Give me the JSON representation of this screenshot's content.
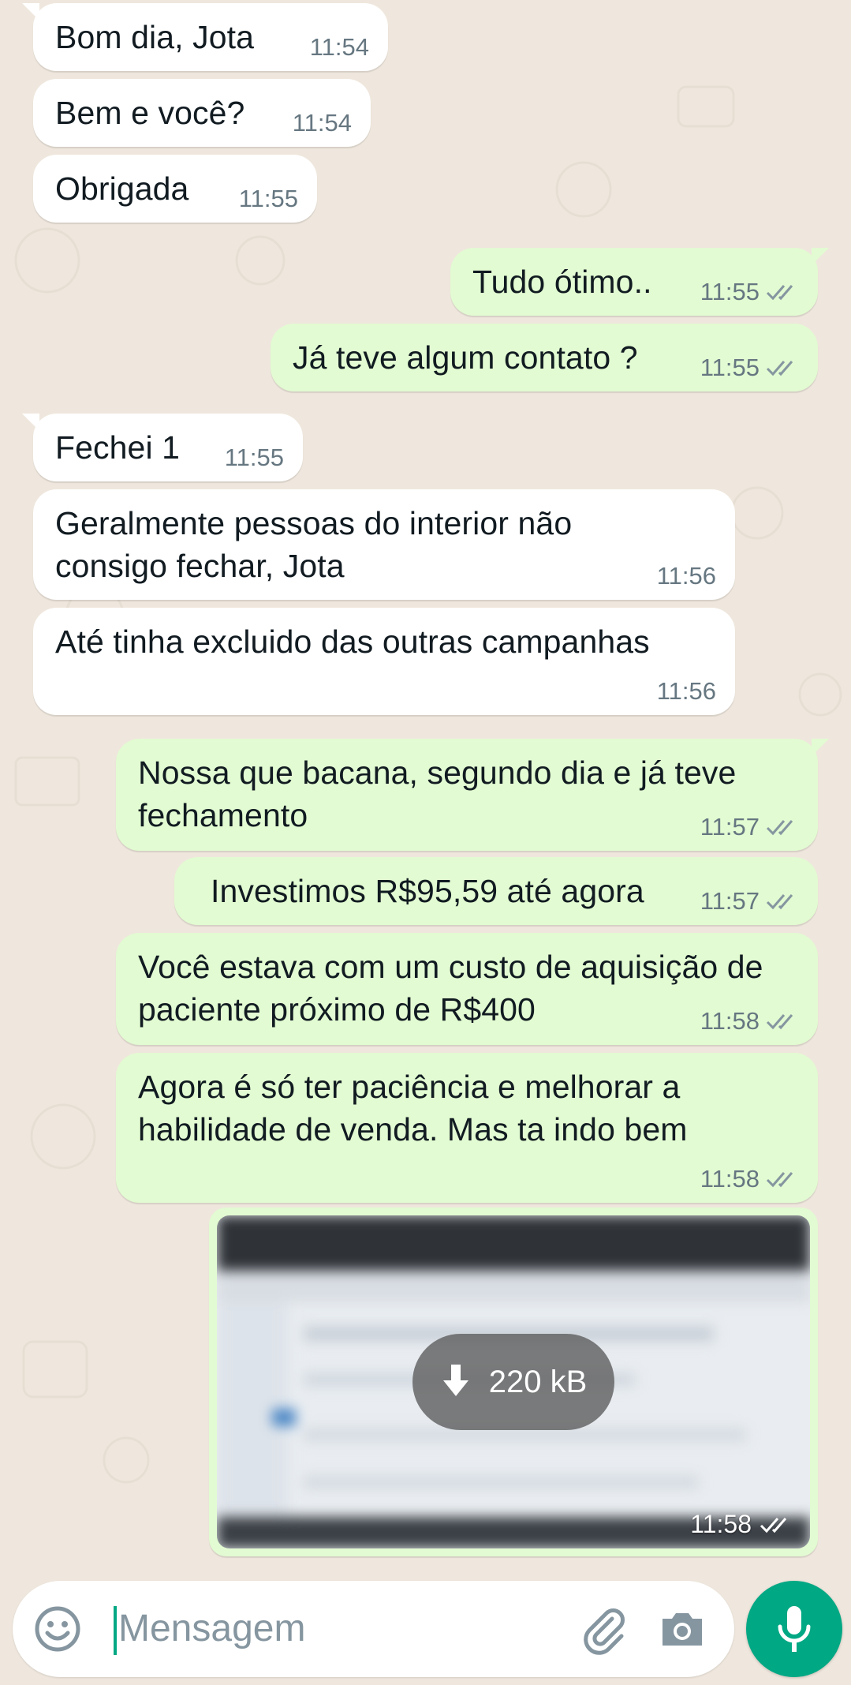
{
  "messages": [
    {
      "dir": "in",
      "text": "Bom dia, Jota",
      "time": "11:54"
    },
    {
      "dir": "in",
      "text": "Bem e você?",
      "time": "11:54"
    },
    {
      "dir": "in",
      "text": "Obrigada",
      "time": "11:55"
    },
    {
      "dir": "out",
      "text": "Tudo ótimo..",
      "time": "11:55"
    },
    {
      "dir": "out",
      "text": "Já teve algum contato ?",
      "time": "11:55"
    },
    {
      "dir": "in",
      "text": "Fechei 1",
      "time": "11:55"
    },
    {
      "dir": "in",
      "text": "Geralmente pessoas do interior não consigo fechar, Jota",
      "time": "11:56"
    },
    {
      "dir": "in",
      "text": "Até tinha excluido das outras campanhas",
      "time": "11:56"
    },
    {
      "dir": "out",
      "text": "Nossa que bacana, segundo dia e já teve fechamento",
      "time": "11:57"
    },
    {
      "dir": "out",
      "text": "Investimos R$95,59 até agora",
      "time": "11:57"
    },
    {
      "dir": "out",
      "text": "Você estava com um custo de aquisição de paciente próximo de R$400",
      "time": "11:58"
    },
    {
      "dir": "out",
      "text": "Agora é só ter paciência e melhorar a habilidade de venda. Mas ta indo bem",
      "time": "11:58"
    }
  ],
  "image_message": {
    "size": "220 kB",
    "time": "11:58"
  },
  "composer": {
    "placeholder": "Mensagem"
  },
  "icons": [
    "emoji-icon",
    "attach-icon",
    "camera-icon",
    "mic-icon",
    "download-icon",
    "double-check-icon"
  ],
  "colors": {
    "background": "#efe7dd",
    "incoming_bubble": "#ffffff",
    "outgoing_bubble": "#e2fbd2",
    "accent": "#00a884",
    "meta_text": "#667781"
  }
}
